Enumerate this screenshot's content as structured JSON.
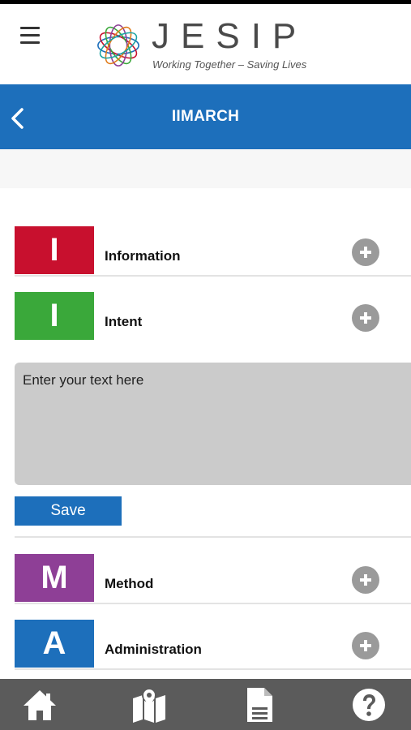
{
  "header": {
    "logo_text": "JESIP",
    "tagline": "Working Together – Saving Lives"
  },
  "titlebar": {
    "title": "IIMARCH"
  },
  "rows": [
    {
      "letter": "I",
      "label": "Information",
      "color": "#c8102e"
    },
    {
      "letter": "I",
      "label": "Intent",
      "color": "#3aa83a"
    },
    {
      "letter": "M",
      "label": "Method",
      "color": "#8e3f96"
    },
    {
      "letter": "A",
      "label": "Administration",
      "color": "#1d6fbb"
    }
  ],
  "editor": {
    "placeholder": "Enter your text here",
    "save_label": "Save"
  },
  "icons": {
    "menu": "hamburger-icon",
    "back": "back-chevron-icon",
    "expand": "plus-circle-icon",
    "home": "home-icon",
    "map": "map-icon",
    "document": "document-icon",
    "help": "help-icon"
  },
  "colors": {
    "brand_blue": "#1d6fbb",
    "bottom_bar": "#5b5b5b",
    "expand_button": "#9a9a9a"
  }
}
